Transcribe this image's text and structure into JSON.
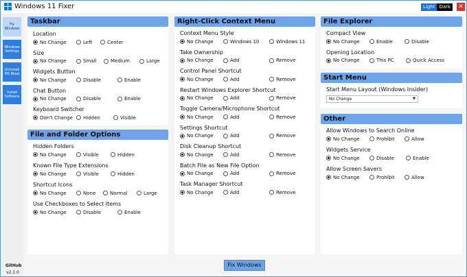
{
  "app": {
    "title": "Windows 11 Fixer",
    "theme_light": "Light",
    "theme_dark": "Dark",
    "close": "✕"
  },
  "sidebar": {
    "items": [
      {
        "label": "Fix Windows"
      },
      {
        "label": "Windows Settings"
      },
      {
        "label": "Uninstall MS Bloat"
      },
      {
        "label": "Install Software"
      }
    ],
    "github": "GitHub",
    "version": "v2.1.0"
  },
  "taskbar": {
    "title": "Taskbar",
    "sections": [
      {
        "label": "Location",
        "options": [
          "No Change",
          "Left",
          "Center"
        ],
        "selected": 0
      },
      {
        "label": "Size",
        "options": [
          "No Change",
          "Small",
          "Medium",
          "Large"
        ],
        "selected": 0
      },
      {
        "label": "Widgets Button",
        "options": [
          "No Change",
          "Disable",
          "Enable"
        ],
        "selected": 0
      },
      {
        "label": "Chat Button",
        "options": [
          "No Change",
          "Disable",
          "Enable"
        ],
        "selected": 0
      },
      {
        "label": "Keyboard Switcher",
        "options": [
          "Don't Change",
          "Hidden",
          "Visible"
        ],
        "selected": 0
      }
    ]
  },
  "file_folder": {
    "title": "File and Folder Options",
    "sections": [
      {
        "label": "Hidden Folders",
        "options": [
          "No Change",
          "Visible",
          "Hidden"
        ],
        "selected": 0
      },
      {
        "label": "Known File Type Extensions",
        "options": [
          "No Change",
          "Visible",
          "Hidden"
        ],
        "selected": 0
      },
      {
        "label": "Shortcut Icons",
        "options": [
          "No Change",
          "None",
          "Normal",
          "Large"
        ],
        "selected": 0
      },
      {
        "label": "Use Checkboxes to Select Items",
        "options": [
          "No Change",
          "Disable",
          "Enable"
        ],
        "selected": 0
      }
    ]
  },
  "context_menu": {
    "title": "Right-Click Context Menu",
    "sections": [
      {
        "label": "Context Menu Style",
        "options": [
          "No Change",
          "Windows 10",
          "Windows 11"
        ],
        "selected": 0
      },
      {
        "label": "Take Ownership",
        "options": [
          "No Change",
          "Add",
          "Remove"
        ],
        "selected": 0
      },
      {
        "label": "Control Panel Shortcut",
        "options": [
          "No Change",
          "Add",
          "Remove"
        ],
        "selected": 0
      },
      {
        "label": "Restart Windows Explorer Shortcut",
        "options": [
          "No Change",
          "Add",
          "Remove"
        ],
        "selected": 0
      },
      {
        "label": "Toggle Camera/Microphone Shortcut",
        "options": [
          "No Change",
          "Add",
          "Remove"
        ],
        "selected": 0
      },
      {
        "label": "Settings Shortcut",
        "options": [
          "No Change",
          "Add",
          "Remove"
        ],
        "selected": 0
      },
      {
        "label": "Disk Cleanup Shortcut",
        "options": [
          "No Change",
          "Add",
          "Remove"
        ],
        "selected": 0
      },
      {
        "label": "Batch File as New File Option",
        "options": [
          "No Change",
          "Add",
          "Remove"
        ],
        "selected": 0
      },
      {
        "label": "Task Manager Shortcut",
        "options": [
          "No Change",
          "Add",
          "Remove"
        ],
        "selected": 0
      }
    ]
  },
  "file_explorer": {
    "title": "File Explorer",
    "sections": [
      {
        "label": "Compact View",
        "options": [
          "No Change",
          "Enable",
          "Disable"
        ],
        "selected": 0
      },
      {
        "label": "Opening Location",
        "options": [
          "No Change",
          "This PC",
          "Quick Access"
        ],
        "selected": 0
      }
    ]
  },
  "start_menu": {
    "title": "Start Menu",
    "layout_label": "Start Menu Layout (Windows Insider)",
    "layout_value": "No Change"
  },
  "other": {
    "title": "Other",
    "sections": [
      {
        "label": "Allow Windows to Search Online",
        "options": [
          "No Change",
          "Prohibit",
          "Allow"
        ],
        "selected": 0
      },
      {
        "label": "Widgets Service",
        "options": [
          "No Change",
          "Disable",
          "Enable"
        ],
        "selected": 0
      },
      {
        "label": "Allow Screen Savers",
        "options": [
          "No Change",
          "Prohibit",
          "Allow"
        ],
        "selected": 0
      }
    ]
  },
  "fix_button": "Fix Windows",
  "colors": {
    "accent": "#6ea3ea",
    "nav": "#2f7de0",
    "close": "#e0322b"
  }
}
